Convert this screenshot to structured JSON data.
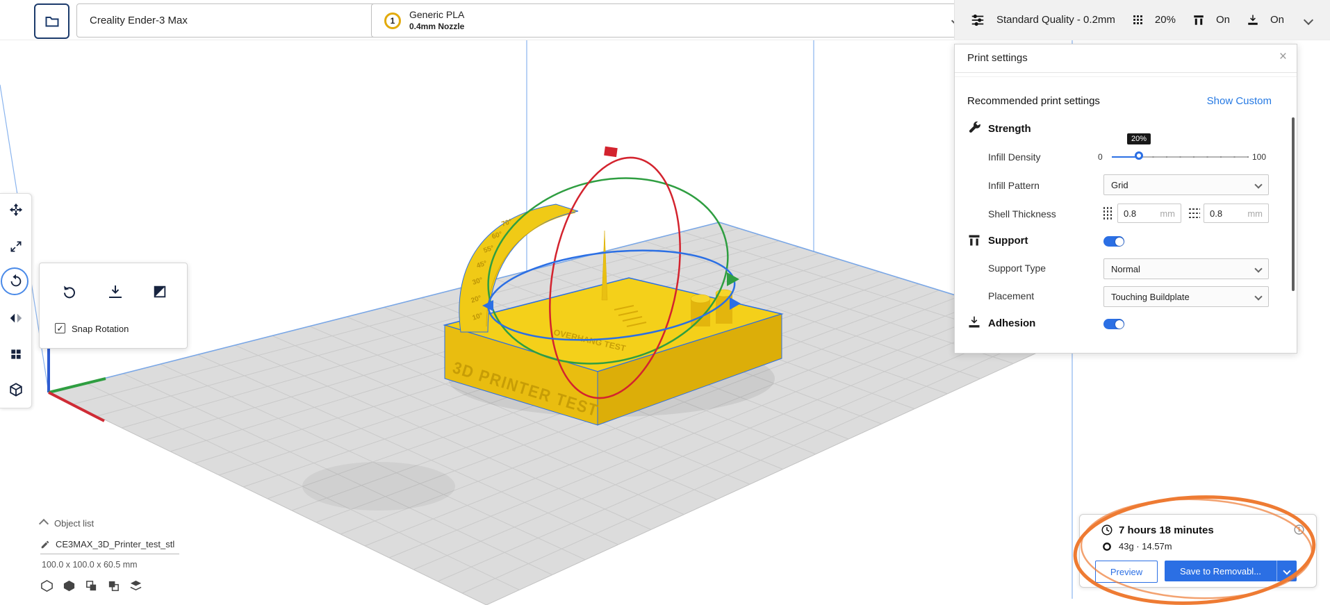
{
  "topbar": {
    "printer": {
      "name": "Creality Ender-3 Max"
    },
    "material": {
      "badge": "1",
      "name": "Generic PLA",
      "nozzle": "0.4mm Nozzle"
    },
    "summary": {
      "profile": "Standard Quality - 0.2mm",
      "infill_value": "20%",
      "support_value": "On",
      "adhesion_value": "On"
    }
  },
  "rotate_panel": {
    "snap_label": "Snap Rotation",
    "checkbox_glyph": "✓"
  },
  "print_settings": {
    "title": "Print settings",
    "close_glyph": "×",
    "recommended_label": "Recommended print settings",
    "show_custom_label": "Show Custom",
    "strength_label": "Strength",
    "infill_density_label": "Infill Density",
    "infill_min": "0",
    "infill_max": "100",
    "infill_value": "20%",
    "infill_percent": 20,
    "infill_pattern_label": "Infill Pattern",
    "infill_pattern_value": "Grid",
    "shell_label": "Shell Thickness",
    "shell_wall_value": "0.8",
    "shell_wall_unit": "mm",
    "shell_top_value": "0.8",
    "shell_top_unit": "mm",
    "support_label": "Support",
    "support_type_label": "Support Type",
    "support_type_value": "Normal",
    "placement_label": "Placement",
    "placement_value": "Touching Buildplate",
    "adhesion_label": "Adhesion"
  },
  "object_list": {
    "title": "Object list",
    "item_name": "CE3MAX_3D_Printer_test_stl",
    "dimensions": "100.0 x 100.0 x 60.5 mm"
  },
  "job": {
    "time": "7 hours 18 minutes",
    "usage": "43g · 14.57m",
    "preview_label": "Preview",
    "save_label": "Save to Removabl..."
  },
  "model": {
    "front_text": "3D PRINTER TEST",
    "overhang_text": "OVERHANG TEST",
    "angles": [
      "10°",
      "20°",
      "30°",
      "45°",
      "55°",
      "60°",
      "70°"
    ]
  },
  "icons": {
    "folder-icon": "folder outline",
    "material-badge": "numbered circle",
    "profile-icon": "sliders",
    "infill-icon": "grid squares",
    "support-icon": "pillars under slab",
    "adhesion-icon": "arrow onto plate",
    "clock-icon": "clock",
    "spool-icon": "filament donut",
    "info-icon": "circled i",
    "pencil-icon": "pencil",
    "close-icon": "×",
    "check-icon": "✓"
  },
  "colors": {
    "accent": "#2b6fe4",
    "model_yellow": "#f4d01a",
    "annotation_orange": "#ee7b33",
    "gizmo_red": "#d3232e",
    "gizmo_green": "#2f9e41",
    "gizmo_blue": "#2b6fe4"
  }
}
